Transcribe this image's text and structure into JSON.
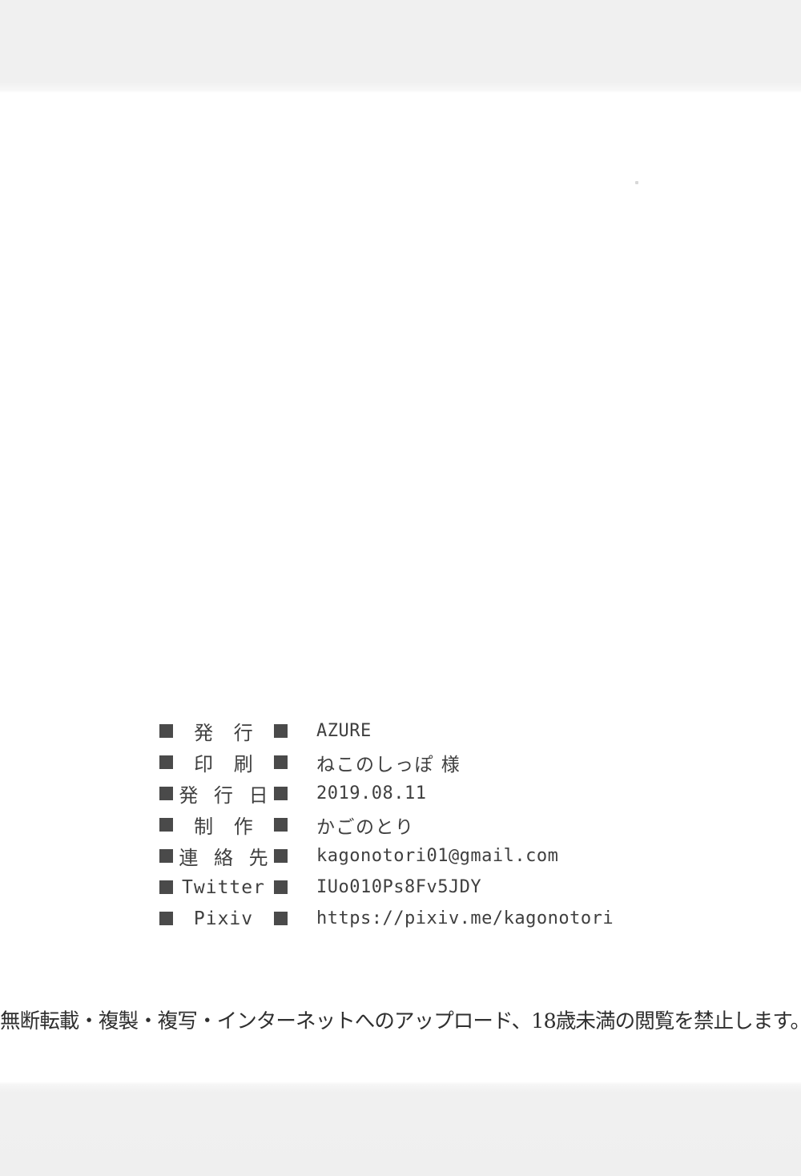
{
  "page": {
    "background_color": "#ffffff",
    "scan_band_color": "#f0f0f0",
    "ink_color": "#3f3f3f",
    "marker_color": "#4a4a4a"
  },
  "colophon": {
    "rows": [
      {
        "label": "発 行",
        "label_kind": "jp",
        "value": "AZURE",
        "value_kind": "mono"
      },
      {
        "label": "印 刷",
        "label_kind": "jp",
        "value": "ねこのしっぽ 様",
        "value_kind": "jp"
      },
      {
        "label": "発 行 日",
        "label_kind": "jp3",
        "value": "2019.08.11",
        "value_kind": "mono"
      },
      {
        "label": "制 作",
        "label_kind": "jp",
        "value": "かごのとり",
        "value_kind": "jp"
      },
      {
        "label": "連 絡 先",
        "label_kind": "jp3",
        "value": "kagonotori01@gmail.com",
        "value_kind": "mono"
      },
      {
        "label": "Twitter",
        "label_kind": "mono",
        "value": "IUo010Ps8Fv5JDY",
        "value_kind": "mono"
      },
      {
        "label": "Pixiv",
        "label_kind": "mono",
        "value": "https://pixiv.me/kagonotori",
        "value_kind": "mono"
      }
    ],
    "marker_glyph": "■"
  },
  "warning": {
    "text": "無断転載・複製・複写・インターネットへのアップロード、18歳未満の閲覧を禁止します。"
  }
}
